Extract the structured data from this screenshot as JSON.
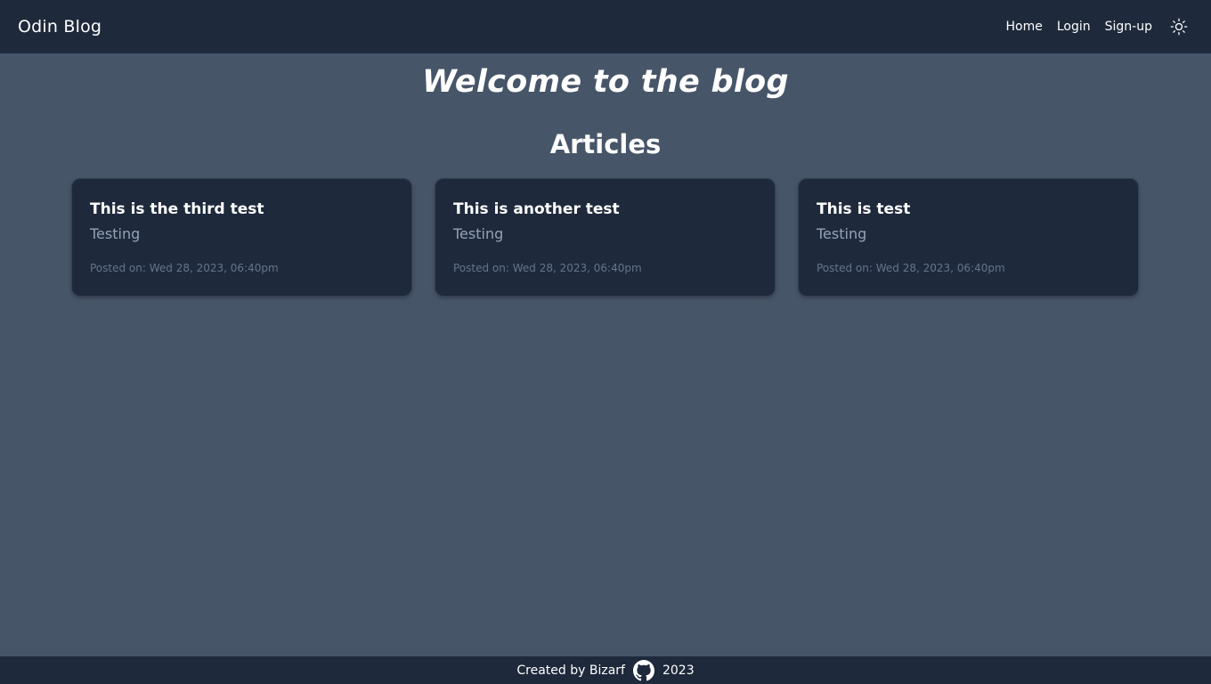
{
  "navbar": {
    "brand": "Odin Blog",
    "links": [
      {
        "label": "Home"
      },
      {
        "label": "Login"
      },
      {
        "label": "Sign-up"
      }
    ],
    "theme_icon": "sun-icon"
  },
  "hero": {
    "title": "Welcome to the blog"
  },
  "articles": {
    "heading": "Articles",
    "items": [
      {
        "title": "This is the third test",
        "subtitle": "Testing",
        "posted": "Posted on: Wed 28, 2023, 06:40pm"
      },
      {
        "title": "This is another test",
        "subtitle": "Testing",
        "posted": "Posted on: Wed 28, 2023, 06:40pm"
      },
      {
        "title": "This is test",
        "subtitle": "Testing",
        "posted": "Posted on: Wed 28, 2023, 06:40pm"
      }
    ]
  },
  "footer": {
    "created_by": "Created by Bizarf",
    "github_icon": "github-icon",
    "year": "2023"
  },
  "colors": {
    "page_bg": "#475569",
    "nav_bg": "#1e293b",
    "card_bg": "#1e293b",
    "muted_text": "#94a3b8"
  }
}
